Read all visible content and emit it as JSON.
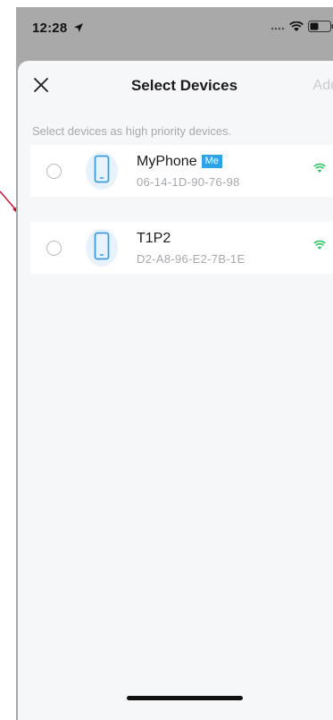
{
  "status_bar": {
    "time": "12:28",
    "icons": [
      "location-arrow-icon",
      "signal-dots-icon",
      "wifi-icon",
      "battery-icon"
    ]
  },
  "nav": {
    "title": "Select Devices",
    "close_icon": "close-icon",
    "action_label": "Add"
  },
  "hint": "Select devices as high priority devices.",
  "devices": [
    {
      "name": "MyPhone",
      "badge": "Me",
      "mac": "06-14-1D-90-76-98",
      "icon": "phone-icon",
      "signal_icon": "wifi-icon"
    },
    {
      "name": "T1P2",
      "badge": "",
      "mac": "D2-A8-96-E2-7B-1E",
      "icon": "phone-icon",
      "signal_icon": "wifi-icon"
    }
  ],
  "colors": {
    "accent": "#2ea3e6",
    "wifi_green": "#35c46a",
    "annotation_arrow": "#c8102e",
    "disabled_text": "#c9cbcf",
    "secondary_text": "#a6a9ae"
  }
}
